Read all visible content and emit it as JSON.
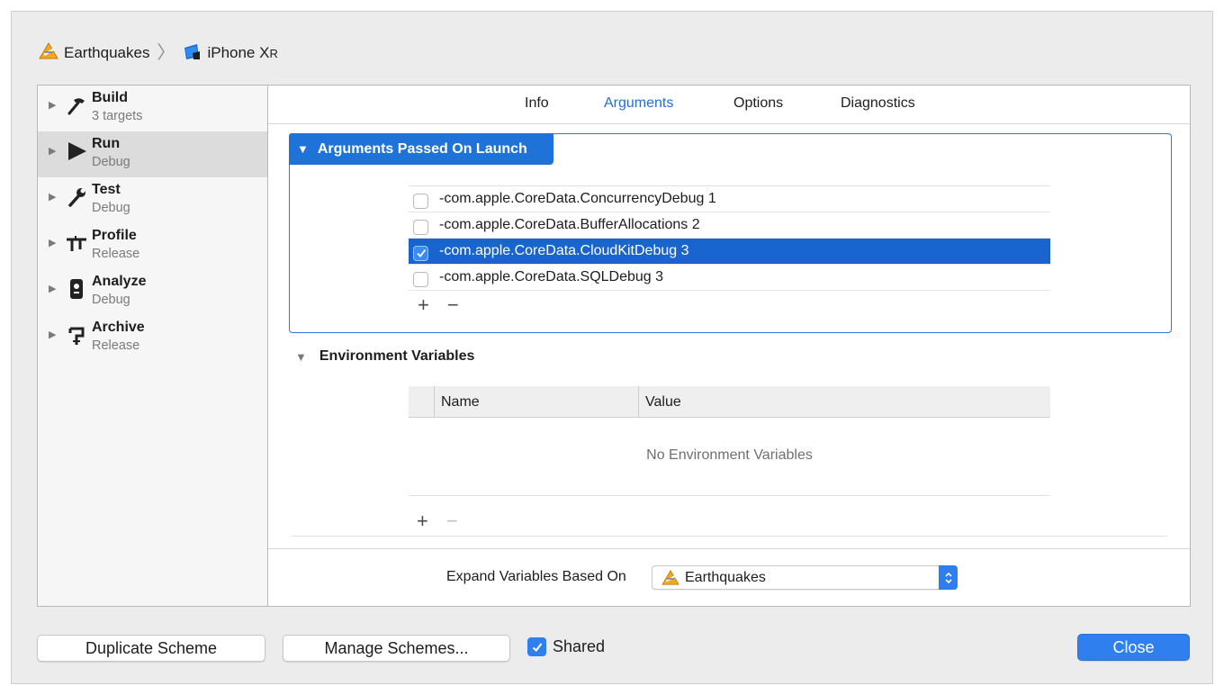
{
  "breadcrumb": {
    "project": "Earthquakes",
    "device": "iPhone X",
    "device_suffix": "R"
  },
  "sidebar": {
    "items": [
      {
        "label": "Build",
        "sub": "3 targets",
        "icon": "hammer-icon"
      },
      {
        "label": "Run",
        "sub": "Debug",
        "icon": "play-icon",
        "selected": true
      },
      {
        "label": "Test",
        "sub": "Debug",
        "icon": "wrench-icon"
      },
      {
        "label": "Profile",
        "sub": "Release",
        "icon": "caliper-icon"
      },
      {
        "label": "Analyze",
        "sub": "Debug",
        "icon": "analyze-icon"
      },
      {
        "label": "Archive",
        "sub": "Release",
        "icon": "archive-icon"
      }
    ]
  },
  "tabs": [
    {
      "label": "Info",
      "active": false
    },
    {
      "label": "Arguments",
      "active": true
    },
    {
      "label": "Options",
      "active": false
    },
    {
      "label": "Diagnostics",
      "active": false
    }
  ],
  "arguments": {
    "header": "Arguments Passed On Launch",
    "rows": [
      {
        "text": "-com.apple.CoreData.ConcurrencyDebug 1",
        "checked": false
      },
      {
        "text": "-com.apple.CoreData.BufferAllocations 2",
        "checked": false
      },
      {
        "text": "-com.apple.CoreData.CloudKitDebug 3",
        "checked": true,
        "selected": true
      },
      {
        "text": "-com.apple.CoreData.SQLDebug 3",
        "checked": false
      }
    ],
    "add": "+",
    "remove": "−"
  },
  "environment": {
    "header": "Environment Variables",
    "columns": [
      "Name",
      "Value"
    ],
    "empty_text": "No Environment Variables",
    "add": "+",
    "remove": "−"
  },
  "expand": {
    "label": "Expand Variables Based On",
    "selected": "Earthquakes"
  },
  "footer": {
    "duplicate": "Duplicate Scheme",
    "manage": "Manage Schemes...",
    "shared_label": "Shared",
    "shared_checked": true,
    "close": "Close"
  },
  "colors": {
    "accent": "#1f73d8",
    "selection": "#1a64cf",
    "window_bg": "#ececec"
  }
}
